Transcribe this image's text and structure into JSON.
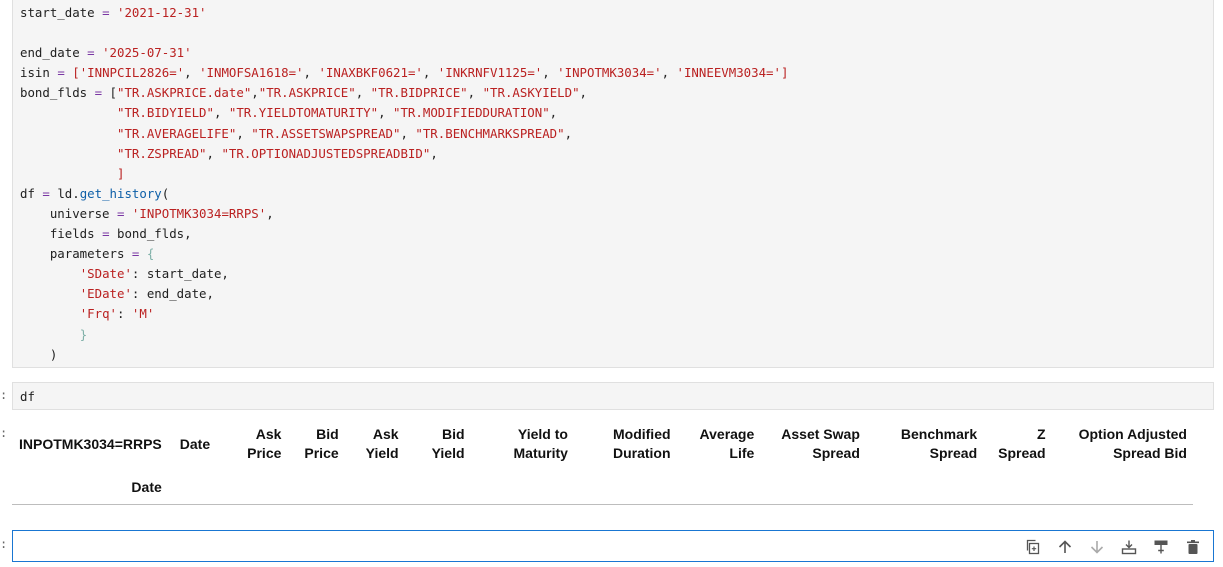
{
  "cell1": {
    "lines": [
      "start_date = '2021-12-31'",
      "",
      "end_date = '2025-07-31'",
      "isin = ['INNPCIL2826=', 'INMOFSA1618=', 'INAXBKF0621=', 'INKRNFV1125=', 'INPOTMK3034=', 'INNEEVM3034=']",
      "bond_flds = [\"TR.ASKPRICE.date\",\"TR.ASKPRICE\", \"TR.BIDPRICE\", \"TR.ASKYIELD\",",
      "             \"TR.BIDYIELD\", \"TR.YIELDTOMATURITY\", \"TR.MODIFIEDDURATION\",",
      "             \"TR.AVERAGELIFE\", \"TR.ASSETSWAPSPREAD\", \"TR.BENCHMARKSPREAD\",",
      "             \"TR.ZSPREAD\", \"TR.OPTIONADJUSTEDSPREADBID\",",
      "             ]",
      "df = ld.get_history(",
      "    universe = 'INPOTMK3034=RRPS',",
      "    fields = bond_flds,",
      "    parameters = {",
      "        'SDate': start_date,",
      "        'EDate': end_date,",
      "        'Frq': 'M'",
      "        }",
      "    )"
    ]
  },
  "cell2": {
    "code": "df"
  },
  "prompts": {
    "mark": ":"
  },
  "output": {
    "index_name": "INPOTMK3034=RRPS",
    "columns": [
      [
        "Date"
      ],
      [
        "Ask",
        "Price"
      ],
      [
        "Bid",
        "Price"
      ],
      [
        "Ask",
        "Yield"
      ],
      [
        "Bid",
        "Yield"
      ],
      [
        "Yield to",
        "Maturity"
      ],
      [
        "Modified",
        "Duration"
      ],
      [
        "Average",
        "Life"
      ],
      [
        "Asset Swap",
        "Spread"
      ],
      [
        "Benchmark",
        "Spread"
      ],
      [
        "Z",
        "Spread"
      ],
      [
        "Option Adjusted",
        "Spread Bid"
      ]
    ],
    "row_index_label": "Date"
  },
  "toolbar": {
    "icons": [
      "copy-icon",
      "move-up-icon",
      "move-down-icon",
      "insert-above-icon",
      "insert-below-icon",
      "delete-icon"
    ]
  }
}
